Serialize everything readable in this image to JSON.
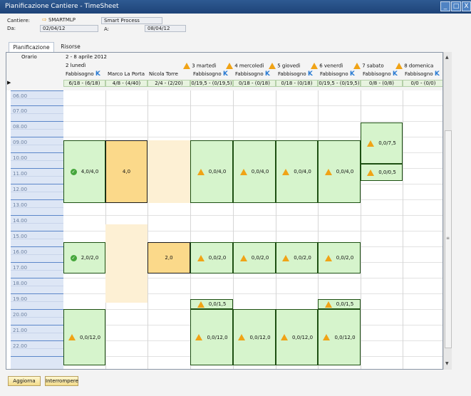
{
  "window": {
    "title": "Pianificazione Cantiere - TimeSheet",
    "controls": [
      "_",
      "□",
      "X"
    ]
  },
  "header": {
    "cantiere_label": "Cantiere:",
    "cantiere_code": "SMARTMLP",
    "cantiere_name": "Smart Process",
    "da_label": "Da:",
    "da_value": "02/04/12",
    "a_label": "A:",
    "a_value": "08/04/12"
  },
  "tabs": [
    {
      "label": "Pianificazione",
      "active": true
    },
    {
      "label": "Risorse",
      "active": false
    }
  ],
  "grid": {
    "orario_label": "Orario",
    "week_label": "2 - 8 aprile 2012",
    "days": [
      {
        "label": "2 lunedì",
        "warning": false
      },
      {
        "label": "3 martedì",
        "warning": true
      },
      {
        "label": "4 mercoledì",
        "warning": true
      },
      {
        "label": "5 giovedì",
        "warning": true
      },
      {
        "label": "6 venerdì",
        "warning": true
      },
      {
        "label": "7 sabato",
        "warning": true
      },
      {
        "label": "8 domenica",
        "warning": true
      }
    ],
    "columns": [
      {
        "name": "Fabbisogno",
        "k": true,
        "summary": "6/18 - (6/18)"
      },
      {
        "name": "Marco La Porta",
        "k": false,
        "summary": "4/8 - (4/40)"
      },
      {
        "name": "Nicola Torre",
        "k": false,
        "summary": "2/4 - (2/20)"
      },
      {
        "name": "Fabbisogno",
        "k": true,
        "summary": "0/19,5 - (0/19,5)"
      },
      {
        "name": "Fabbisogno",
        "k": true,
        "summary": "0/18 - (0/18)"
      },
      {
        "name": "Fabbisogno",
        "k": true,
        "summary": "0/18 - (0/18)"
      },
      {
        "name": "Fabbisogno",
        "k": true,
        "summary": "0/19,5 - (0/19,5)"
      },
      {
        "name": "Fabbisogno",
        "k": true,
        "summary": "0/8 - (0/8)"
      },
      {
        "name": "Fabbisogno",
        "k": true,
        "summary": "0/0 - (0/0)"
      }
    ],
    "hours": [
      "06.00",
      "07.00",
      "08.00",
      "09.00",
      "10.00",
      "11.00",
      "12.00",
      "13.00",
      "14.00",
      "15.00",
      "16.00",
      "17.00",
      "18.00",
      "19.00",
      "20.00",
      "21.00",
      "22.00"
    ],
    "events": {
      "mon_am": "4,0/4,0",
      "marco_am": "4,0",
      "tue_am": "0,0/4,0",
      "wed_am": "0,0/4,0",
      "thu_am": "0,0/4,0",
      "fri_am": "0,0/4,0",
      "sat_1": "0,0/7,5",
      "sat_2": "0,0/0,5",
      "mon_pm": "2,0/2,0",
      "nicola_pm": "2,0",
      "tue_pm": "0,0/2,0",
      "wed_pm": "0,0/2,0",
      "thu_pm": "0,0/2,0",
      "fri_pm": "0,0/2,0",
      "tue_ev1": "0,0/1,5",
      "fri_ev1": "0,0/1,5",
      "mon_ev": "0,0/12,0",
      "tue_ev": "0,0/12,0",
      "wed_ev": "0,0/12,0",
      "thu_ev": "0,0/12,0",
      "fri_ev": "0,0/12,0"
    }
  },
  "footer": {
    "aggiorna": "Aggiorna",
    "interrompere": "Interrompere"
  }
}
